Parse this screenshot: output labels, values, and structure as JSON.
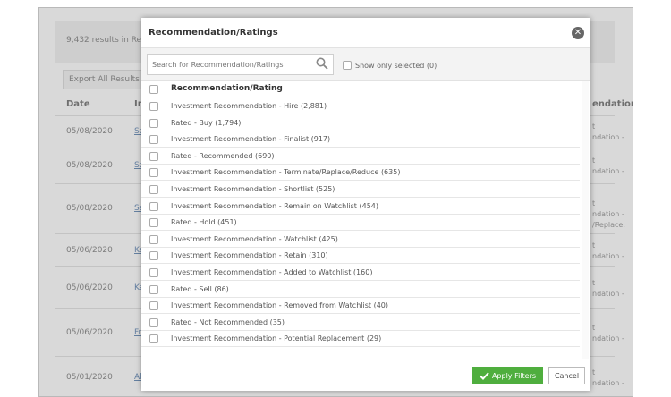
{
  "background": {
    "results_text": "9,432 results in Rec",
    "export_label": "Export All Results",
    "columns": {
      "date": "Date",
      "type": "Ir",
      "recommendation": "endation"
    },
    "rows": [
      {
        "date": "05/08/2020",
        "link": "Sa",
        "right": [
          "t",
          "ndation -"
        ]
      },
      {
        "date": "05/08/2020",
        "link": "Sa",
        "right": [
          "t",
          "ndation -"
        ]
      },
      {
        "date": "05/08/2020",
        "link": "Sa",
        "right": [
          "t",
          "ndation -",
          "/Replace,"
        ]
      },
      {
        "date": "05/06/2020",
        "link": "Ka",
        "right": [
          "t",
          "ndation -"
        ]
      },
      {
        "date": "05/06/2020",
        "link": "Ka",
        "right": [
          "t",
          "ndation -"
        ]
      },
      {
        "date": "05/06/2020",
        "link": "Fr",
        "right": [
          "t",
          "ndation -"
        ]
      },
      {
        "date": "05/01/2020",
        "link": "Al",
        "right": [
          "t",
          "ndation -"
        ]
      }
    ]
  },
  "modal": {
    "title": "Recommendation/Ratings",
    "search_placeholder": "Search for Recommendation/Ratings",
    "show_selected_label": "Show only selected (0)",
    "header_label": "Recommendation/Rating",
    "options": [
      "Investment Recommendation - Hire (2,881)",
      "Rated - Buy (1,794)",
      "Investment Recommendation - Finalist (917)",
      "Rated - Recommended (690)",
      "Investment Recommendation - Terminate/Replace/Reduce (635)",
      "Investment Recommendation - Shortlist (525)",
      "Investment Recommendation - Remain on Watchlist (454)",
      "Rated - Hold (451)",
      "Investment Recommendation - Watchlist (425)",
      "Investment Recommendation - Retain (310)",
      "Investment Recommendation - Added to Watchlist (160)",
      "Rated - Sell (86)",
      "Investment Recommendation - Removed from Watchlist (40)",
      "Rated - Not Recommended (35)",
      "Investment Recommendation - Potential Replacement (29)"
    ],
    "apply_label": "Apply Filters",
    "cancel_label": "Cancel"
  },
  "colors": {
    "accent_green": "#4fae3e",
    "close_grey": "#666666"
  },
  "icons": {
    "close": "close-circle-icon",
    "search": "search-icon",
    "apply": "checkmark-icon"
  }
}
